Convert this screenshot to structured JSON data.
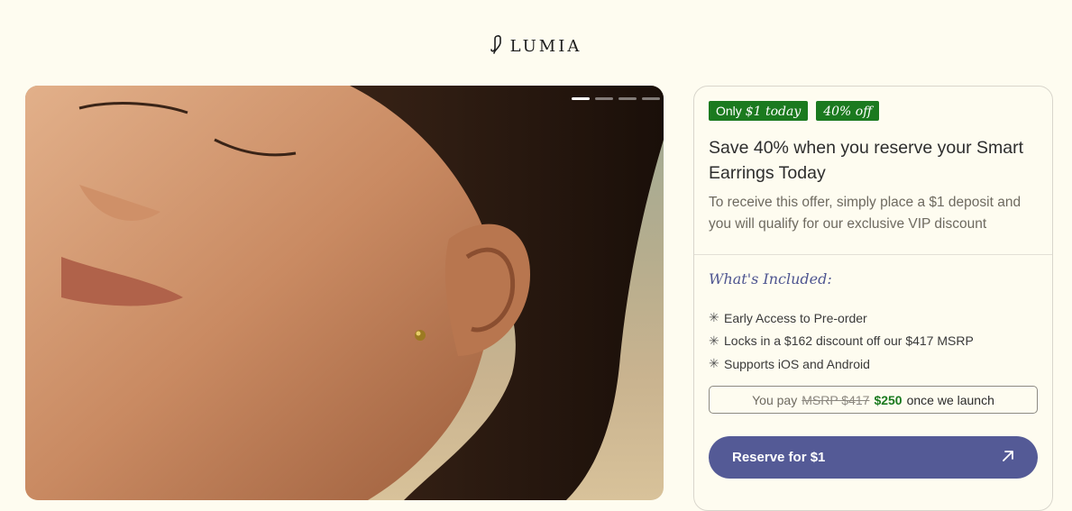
{
  "brand": {
    "name": "LUMIA",
    "logo_icon": "earring-hook-icon"
  },
  "carousel": {
    "slide_count": 4,
    "active_index": 0
  },
  "offer": {
    "badge_1_prefix": "Only",
    "badge_1_emphasis": "$1 today",
    "badge_2": "40% off",
    "headline": "Save 40% when you reserve your Smart Earrings Today",
    "subtext": "To receive this offer, simply place a $1 deposit and you will qualify for our exclusive VIP discount",
    "included_title": "What's Included:",
    "included_items": [
      "Early Access to Pre-order",
      "Locks in a $162 discount off our $417 MSRP",
      "Supports iOS and Android"
    ],
    "price": {
      "prefix": "You pay",
      "msrp": "MSRP $417",
      "sale": "$250",
      "suffix": "once we launch"
    },
    "cta_label": "Reserve for $1",
    "cta_icon": "arrow-up-right-icon"
  },
  "colors": {
    "page_bg": "#fefcf0",
    "badge_green": "#1b7a1f",
    "accent_purple": "#545a96",
    "included_title": "#4e5590"
  }
}
